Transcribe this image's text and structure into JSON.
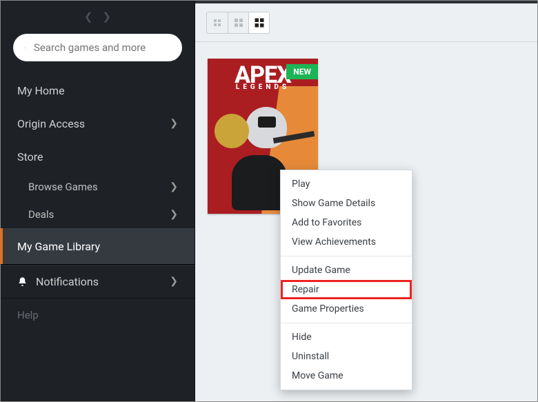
{
  "sidebar": {
    "search_placeholder": "Search games and more",
    "items": [
      {
        "label": "My Home",
        "chevron": false
      },
      {
        "label": "Origin Access",
        "chevron": true
      },
      {
        "label": "Store",
        "chevron": false
      },
      {
        "label": "Browse Games",
        "chevron": true
      },
      {
        "label": "Deals",
        "chevron": true
      },
      {
        "label": "My Game Library",
        "chevron": false
      }
    ],
    "notifications_label": "Notifications",
    "help_label": "Help"
  },
  "game_card": {
    "title_line1": "APEX",
    "title_line2": "LEGENDS",
    "badge": "NEW"
  },
  "context_menu": {
    "sections": [
      [
        "Play",
        "Show Game Details",
        "Add to Favorites",
        "View Achievements"
      ],
      [
        "Update Game",
        "Repair",
        "Game Properties"
      ],
      [
        "Hide",
        "Uninstall",
        "Move Game"
      ]
    ],
    "highlighted": "Repair"
  },
  "colors": {
    "accent": "#ff6a00",
    "badge_green": "#1db455",
    "sidebar_bg": "#1e2227"
  }
}
